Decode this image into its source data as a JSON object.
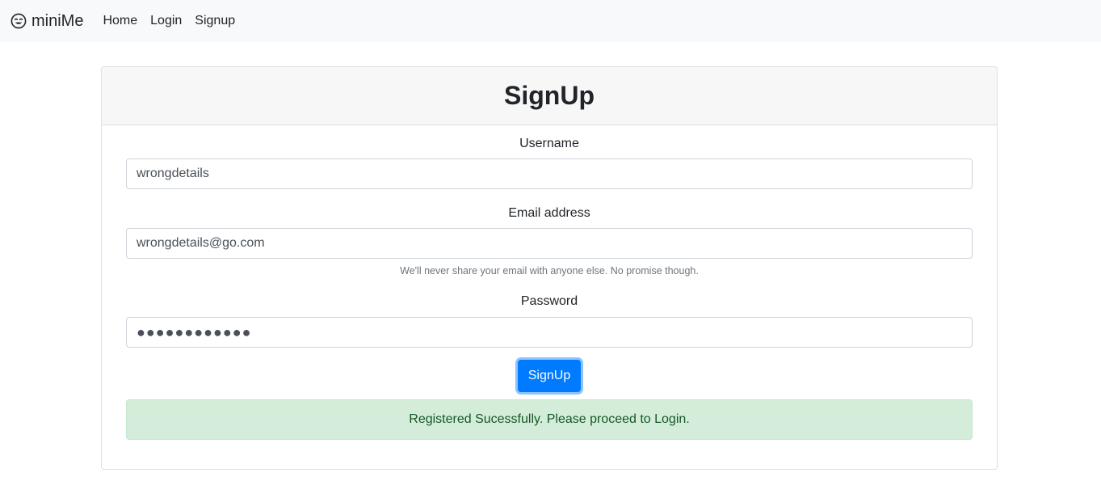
{
  "navbar": {
    "brand_icon": "smiley-face-icon",
    "brand": "miniMe",
    "links": [
      {
        "label": "Home"
      },
      {
        "label": "Login"
      },
      {
        "label": "Signup"
      }
    ]
  },
  "card": {
    "title": "SignUp"
  },
  "form": {
    "username": {
      "label": "Username",
      "value": "wrongdetails"
    },
    "email": {
      "label": "Email address",
      "value": "wrongdetails@go.com",
      "help": "We'll never share your email with anyone else. No promise though."
    },
    "password": {
      "label": "Password",
      "value": "●●●●●●●●●●●●"
    },
    "submit_label": "SignUp"
  },
  "alert": {
    "message": "Registered Sucessfully. Please proceed to Login."
  },
  "colors": {
    "primary": "#007bff",
    "success_bg": "#d4edda",
    "success_text": "#155724",
    "navbar_bg": "#f8f9fa"
  }
}
